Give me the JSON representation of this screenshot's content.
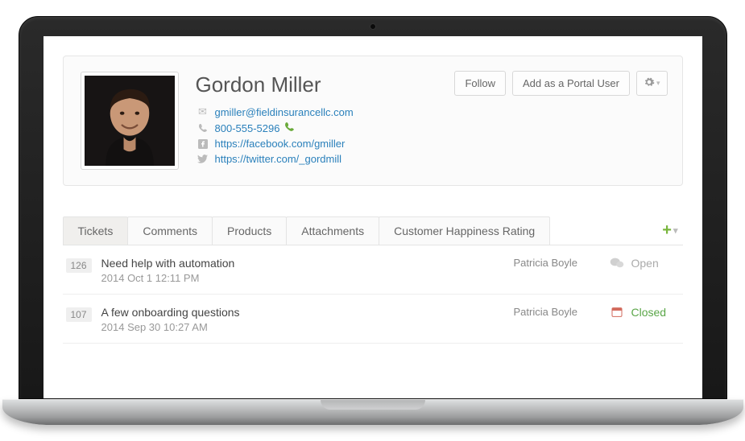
{
  "profile": {
    "name": "Gordon Miller",
    "email": "gmiller@fieldinsurancellc.com",
    "phone": "800-555-5296",
    "facebook": "https://facebook.com/gmiller",
    "twitter": "https://twitter.com/_gordmill"
  },
  "actions": {
    "follow": "Follow",
    "addPortal": "Add as a Portal User"
  },
  "tabs": {
    "items": [
      "Tickets",
      "Comments",
      "Products",
      "Attachments",
      "Customer Happiness Rating"
    ],
    "active": 0
  },
  "tickets": [
    {
      "id": "126",
      "title": "Need help with automation",
      "date": "2014 Oct 1 12:11 PM",
      "assignee": "Patricia Boyle",
      "status": "Open",
      "statusClass": "open",
      "typeClass": ""
    },
    {
      "id": "107",
      "title": "A few onboarding questions",
      "date": "2014 Sep 30 10:27 AM",
      "assignee": "Patricia Boyle",
      "status": "Closed",
      "statusClass": "closed",
      "typeClass": "priority"
    }
  ]
}
